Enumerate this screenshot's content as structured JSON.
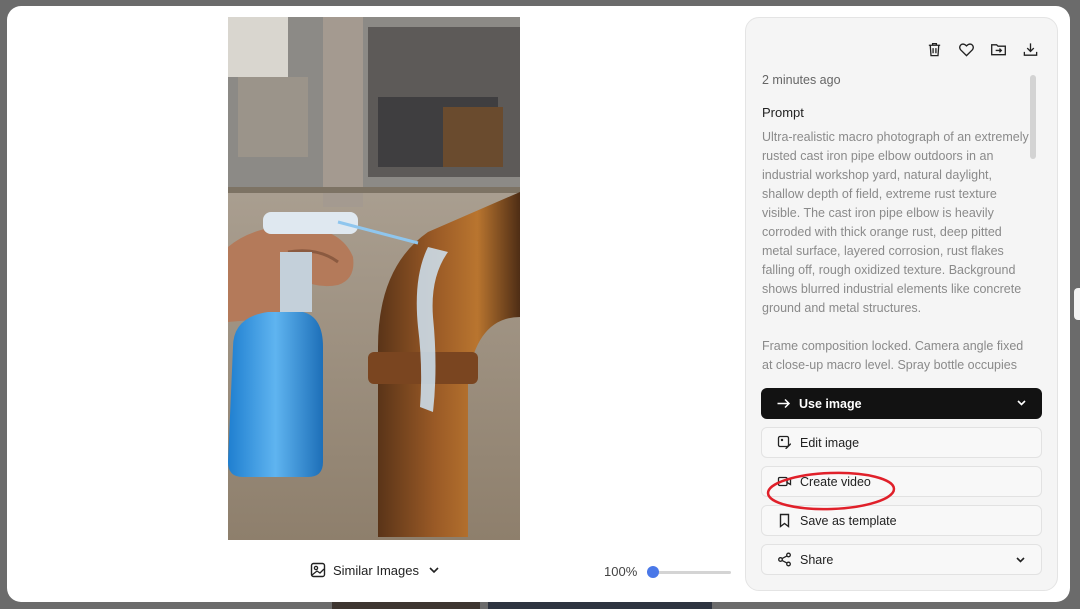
{
  "photo": {
    "alt": "Rusted cast iron pipe elbow being sprayed with a blue spray bottle"
  },
  "bottom_bar": {
    "similar_label": "Similar Images",
    "zoom_label": "100%"
  },
  "panel": {
    "timestamp": "2 minutes ago",
    "prompt_label": "Prompt",
    "prompt_text": "Ultra-realistic macro photograph of an extremely rusted cast iron pipe elbow outdoors in an industrial workshop yard, natural daylight, shallow depth of field, extreme rust texture visible. The cast iron pipe elbow is heavily corroded with thick orange rust, deep pitted metal surface, layered corrosion, rust flakes falling off, rough oxidized texture. Background shows blurred industrial elements like concrete ground and metal structures.\n\nFrame composition locked. Camera angle fixed at close-up macro level. Spray bottle occupies",
    "buttons": {
      "use_image": "Use image",
      "edit_image": "Edit image",
      "create_video": "Create video",
      "save_template": "Save as template",
      "share": "Share"
    }
  },
  "colors": {
    "accent": "#4a78e8",
    "annotation": "#e0202a",
    "primary_button": "#121212"
  }
}
